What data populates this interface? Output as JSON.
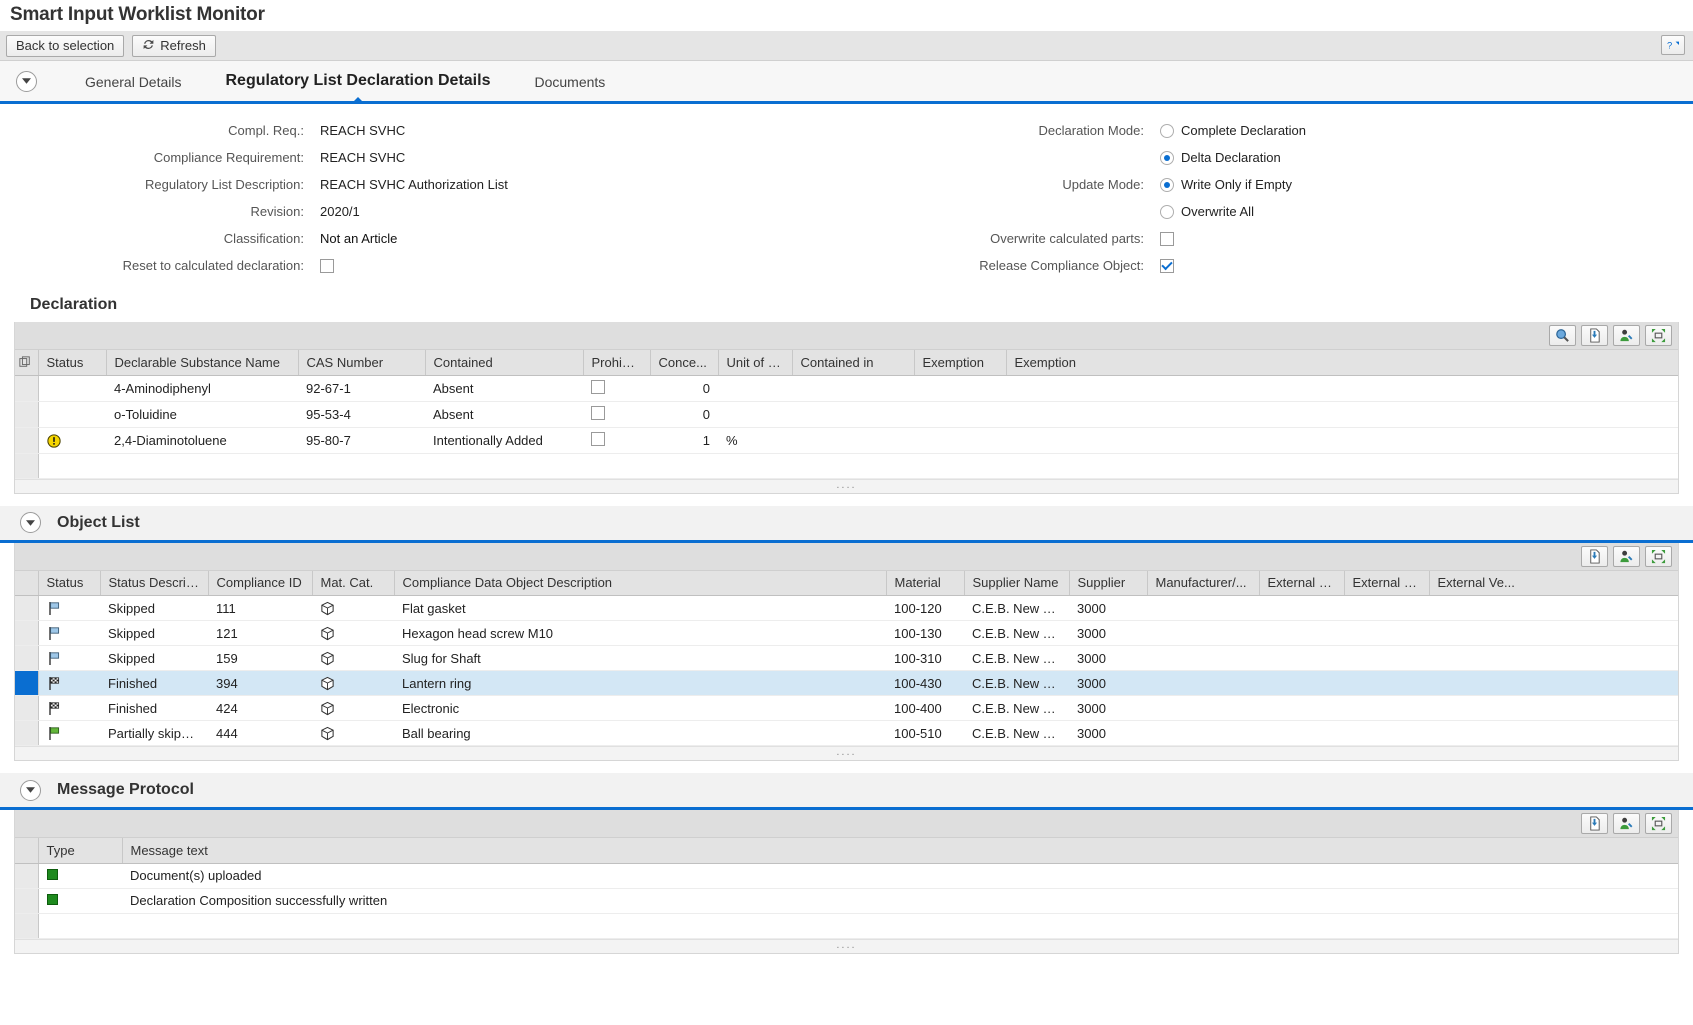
{
  "app": {
    "title": "Smart Input Worklist Monitor",
    "buttons": {
      "back": "Back to selection",
      "refresh": "Refresh"
    },
    "help_label": "?"
  },
  "tabs": [
    {
      "label": "General Details",
      "active": false
    },
    {
      "label": "Regulatory List Declaration Details",
      "active": true
    },
    {
      "label": "Documents",
      "active": false
    }
  ],
  "form": {
    "left": [
      {
        "label": "Compl. Req.:",
        "value": "REACH SVHC",
        "type": "text"
      },
      {
        "label": "Compliance Requirement:",
        "value": "REACH SVHC",
        "type": "text"
      },
      {
        "label": "Regulatory List Description:",
        "value": "REACH SVHC Authorization List",
        "type": "text"
      },
      {
        "label": "Revision:",
        "value": "2020/1",
        "type": "text"
      },
      {
        "label": "Classification:",
        "value": "Not an Article",
        "type": "text"
      },
      {
        "label": "Reset to calculated declaration:",
        "value": "",
        "type": "checkbox",
        "checked": false
      }
    ],
    "right": {
      "declaration_mode_label": "Declaration Mode:",
      "declaration_mode_options": [
        {
          "label": "Complete Declaration",
          "selected": false
        },
        {
          "label": "Delta Declaration",
          "selected": true
        }
      ],
      "update_mode_label": "Update Mode:",
      "update_mode_options": [
        {
          "label": "Write Only if Empty",
          "selected": true
        },
        {
          "label": "Overwrite All",
          "selected": false
        }
      ],
      "overwrite_calculated_label": "Overwrite calculated parts:",
      "overwrite_calculated_checked": false,
      "release_compliance_label": "Release Compliance Object:",
      "release_compliance_checked": true
    }
  },
  "declaration": {
    "title": "Declaration",
    "toolbar_icons": [
      "search-icon",
      "export-document-icon",
      "personalize-icon",
      "fullscreen-icon"
    ],
    "columns": [
      "Status",
      "Declarable Substance Name",
      "CAS Number",
      "Contained",
      "Prohibi...",
      "Conce...",
      "Unit of Co...",
      "Contained in",
      "Exemption",
      "Exemption"
    ],
    "rows": [
      {
        "status_icon": "",
        "substance": "4-Aminodiphenyl",
        "cas": "92-67-1",
        "contained": "Absent",
        "prohibited": false,
        "concentration": "0",
        "unit": "",
        "contained_in": "",
        "exemption1": "",
        "exemption2": ""
      },
      {
        "status_icon": "",
        "substance": "o-Toluidine",
        "cas": "95-53-4",
        "contained": "Absent",
        "prohibited": false,
        "concentration": "0",
        "unit": "",
        "contained_in": "",
        "exemption1": "",
        "exemption2": ""
      },
      {
        "status_icon": "warning",
        "substance": "2,4-Diaminotoluene",
        "cas": "95-80-7",
        "contained": "Intentionally Added",
        "prohibited": false,
        "concentration": "1",
        "unit": "%",
        "contained_in": "",
        "exemption1": "",
        "exemption2": ""
      }
    ]
  },
  "object_list": {
    "title": "Object List",
    "toolbar_icons": [
      "export-document-icon",
      "personalize-icon",
      "fullscreen-icon"
    ],
    "columns": [
      "Status",
      "Status Descrip...",
      "Compliance ID",
      "Mat. Cat.",
      "Compliance Data Object Description",
      "Material",
      "Supplier Name",
      "Supplier",
      "Manufacturer/...",
      "External M...",
      "External M...",
      "External Ve..."
    ],
    "rows": [
      {
        "status_icon": "flag-blue",
        "status_desc": "Skipped",
        "compliance_id": "111",
        "mat_cat": "box-icon",
        "description": "Flat gasket",
        "material": "100-120",
        "supplier_name": "C.E.B. New York",
        "supplier": "3000",
        "manufacturer": "",
        "ext_m1": "",
        "ext_m2": "",
        "ext_ve": "",
        "selected": false
      },
      {
        "status_icon": "flag-blue",
        "status_desc": "Skipped",
        "compliance_id": "121",
        "mat_cat": "box-icon",
        "description": "Hexagon head screw M10",
        "material": "100-130",
        "supplier_name": "C.E.B. New York",
        "supplier": "3000",
        "manufacturer": "",
        "ext_m1": "",
        "ext_m2": "",
        "ext_ve": "",
        "selected": false
      },
      {
        "status_icon": "flag-blue",
        "status_desc": "Skipped",
        "compliance_id": "159",
        "mat_cat": "box-icon",
        "description": "Slug for Shaft",
        "material": "100-310",
        "supplier_name": "C.E.B. New York",
        "supplier": "3000",
        "manufacturer": "",
        "ext_m1": "",
        "ext_m2": "",
        "ext_ve": "",
        "selected": false
      },
      {
        "status_icon": "flag-checkered",
        "status_desc": "Finished",
        "compliance_id": "394",
        "mat_cat": "box-icon",
        "description": "Lantern ring",
        "material": "100-430",
        "supplier_name": "C.E.B. New York",
        "supplier": "3000",
        "manufacturer": "",
        "ext_m1": "",
        "ext_m2": "",
        "ext_ve": "",
        "selected": true
      },
      {
        "status_icon": "flag-checkered",
        "status_desc": "Finished",
        "compliance_id": "424",
        "mat_cat": "box-icon",
        "description": "Electronic",
        "material": "100-400",
        "supplier_name": "C.E.B. New York",
        "supplier": "3000",
        "manufacturer": "",
        "ext_m1": "",
        "ext_m2": "",
        "ext_ve": "",
        "selected": false
      },
      {
        "status_icon": "flag-green",
        "status_desc": "Partially skipped",
        "compliance_id": "444",
        "mat_cat": "box-icon",
        "description": "Ball bearing",
        "material": "100-510",
        "supplier_name": "C.E.B. New York",
        "supplier": "3000",
        "manufacturer": "",
        "ext_m1": "",
        "ext_m2": "",
        "ext_ve": "",
        "selected": false
      }
    ]
  },
  "message_protocol": {
    "title": "Message Protocol",
    "toolbar_icons": [
      "export-document-icon",
      "personalize-icon",
      "fullscreen-icon"
    ],
    "columns": [
      "Type",
      "Message text"
    ],
    "rows": [
      {
        "type_icon": "success",
        "text": "Document(s) uploaded"
      },
      {
        "type_icon": "success",
        "text": "Declaration Composition successfully written"
      }
    ]
  },
  "colors": {
    "accent": "#0a6ed1",
    "link": "#0a6ed1",
    "selected_row": "#d3e7f5",
    "header_bg": "#e3e3e3",
    "warning": "#f5d500",
    "success": "#1e8a1e"
  },
  "resize_dots": "...."
}
